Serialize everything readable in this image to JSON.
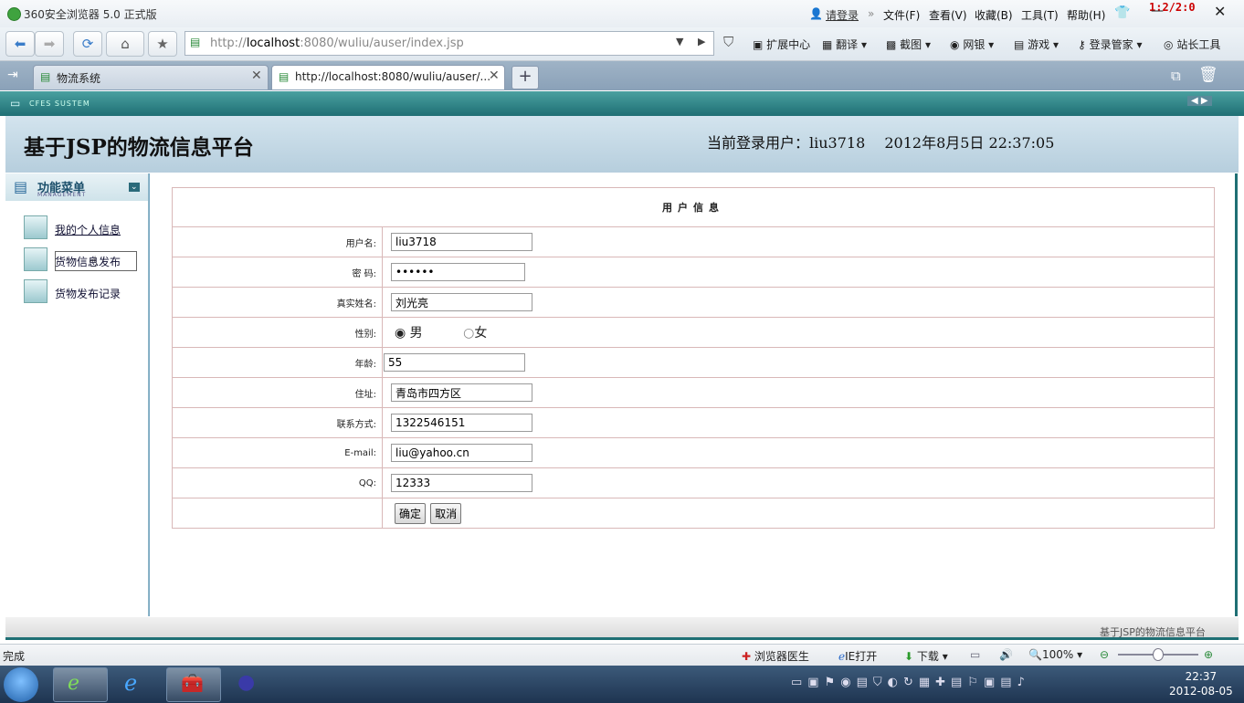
{
  "window": {
    "title": "360安全浏览器 5.0 正式版",
    "login_link": "请登录",
    "badge": "1:2/2:0",
    "menus": [
      "文件(F)",
      "查看(V)",
      "收藏(B)",
      "工具(T)",
      "帮助(H)"
    ]
  },
  "toolbar": {
    "address_prefix": "http://",
    "address_host": "localhost",
    "address_rest": ":8080/wuliu/auser/index.jsp",
    "items": [
      "扩展中心",
      "翻译",
      "截图",
      "网银",
      "游戏",
      "登录管家",
      "站长工具"
    ]
  },
  "tabs": [
    {
      "label": "物流系统"
    },
    {
      "label": "http://localhost:8080/wuliu/auser/..."
    }
  ],
  "frame": {
    "band_label": "CFES SUSTEM",
    "site_title": "基于JSP的物流信息平台",
    "login_info": "当前登录用户：liu3718　 2012年8月5日  22:37:05"
  },
  "sidebar": {
    "title": "功能菜单",
    "subtitle": "MANAGEMENT",
    "items": [
      {
        "label": "我的个人信息"
      },
      {
        "label": "货物信息发布"
      },
      {
        "label": "货物发布记录"
      }
    ]
  },
  "form": {
    "header": "用户信息",
    "username_label": "用户名:",
    "username": "liu3718",
    "password_label": "密  码:",
    "password": "••••••",
    "realname_label": "真实姓名:",
    "realname": "刘光亮",
    "gender_label": "性别:",
    "gender_male": "男",
    "gender_female": "女",
    "age_label": "年龄:",
    "age": "55",
    "address_label": "住址:",
    "address": "青岛市四方区",
    "contact_label": "联系方式:",
    "contact": "1322546151",
    "email_label": "E-mail:",
    "email": "liu@yahoo.cn",
    "qq_label": "QQ:",
    "qq": "12333",
    "confirm": "确定",
    "cancel": "取消"
  },
  "footer": {
    "text": "基于JSP的物流信息平台"
  },
  "statusbar": {
    "left": "完成",
    "doctor": "浏览器医生",
    "ie_open": "IE打开",
    "download": "下载",
    "zoom": "100%"
  },
  "taskbar": {
    "time": "22:37",
    "date": "2012-08-05"
  }
}
